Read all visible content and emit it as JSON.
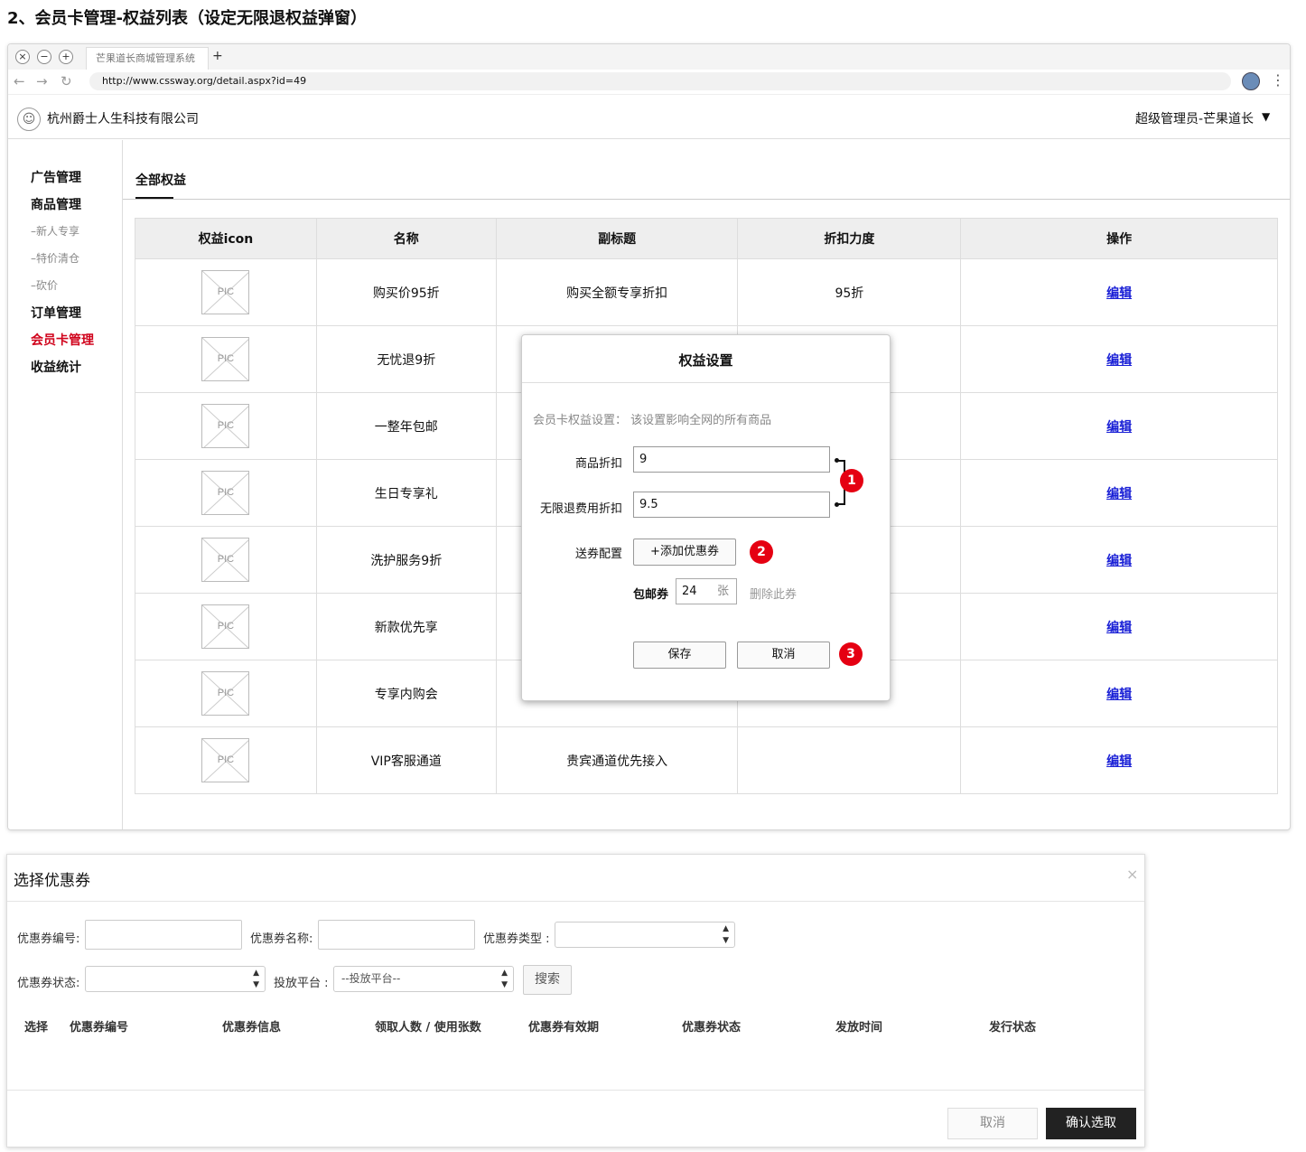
{
  "page_heading": "2、会员卡管理-权益列表（设定无限退权益弹窗）",
  "browser": {
    "window_buttons": [
      "×",
      "−",
      "+"
    ],
    "tab_title": "芒果道长商城管理系统",
    "new_tab": "+",
    "url": "http://www.cssway.org/detail.aspx?id=49"
  },
  "header": {
    "company": "杭州爵士人生科技有限公司",
    "user": "超级管理员-芒果道长"
  },
  "sidebar": {
    "items": [
      {
        "label": "广告管理",
        "type": "main"
      },
      {
        "label": "商品管理",
        "type": "main"
      },
      {
        "label": "–新人专享",
        "type": "sub"
      },
      {
        "label": "–特价清仓",
        "type": "sub"
      },
      {
        "label": "–砍价",
        "type": "sub"
      },
      {
        "label": "订单管理",
        "type": "main"
      },
      {
        "label": "会员卡管理",
        "type": "active"
      },
      {
        "label": "收益统计",
        "type": "main"
      }
    ]
  },
  "content": {
    "tab": "全部权益",
    "table": {
      "headers": [
        "权益icon",
        "名称",
        "副标题",
        "折扣力度",
        "操作"
      ],
      "pic_label": "PIC",
      "edit_label": "编辑",
      "rows": [
        {
          "name": "购买价95折",
          "subtitle": "购买全额专享折扣",
          "discount": "95折"
        },
        {
          "name": "无忧退9折",
          "subtitle": "",
          "discount": ""
        },
        {
          "name": "一整年包邮",
          "subtitle": "",
          "discount": ""
        },
        {
          "name": "生日专享礼",
          "subtitle": "",
          "discount": ""
        },
        {
          "name": "洗护服务9折",
          "subtitle": "",
          "discount": ""
        },
        {
          "name": "新款优先享",
          "subtitle": "",
          "discount": ""
        },
        {
          "name": "专享内购会",
          "subtitle": "",
          "discount": ""
        },
        {
          "name": "VIP客服通道",
          "subtitle": "贵宾通道优先接入",
          "discount": ""
        }
      ]
    }
  },
  "modal": {
    "title": "权益设置",
    "hint": "会员卡权益设置： 该设置影响全网的所有商品",
    "goods_discount_label": "商品折扣",
    "goods_discount_value": "9",
    "return_fee_label": "无限退费用折扣",
    "return_fee_value": "9.5",
    "coupon_config_label": "送券配置",
    "add_coupon_label": "+添加优惠券",
    "coupon_name": "包邮券",
    "coupon_qty": "24",
    "coupon_unit": "张",
    "delete_coupon": "删除此券",
    "save": "保存",
    "cancel": "取消",
    "badges": [
      "1",
      "2",
      "3"
    ],
    "badge_color": "#e50012"
  },
  "coupon_dialog": {
    "title": "选择优惠券",
    "close": "×",
    "code_label": "优惠券编号:",
    "name_label": "优惠券名称:",
    "type_label": "优惠券类型 :",
    "status_label": "优惠券状态:",
    "platform_label": "投放平台 :",
    "platform_placeholder": "--投放平台--",
    "search": "搜索",
    "columns": [
      "选择",
      "优惠券编号",
      "优惠券信息",
      "领取人数 / 使用张数",
      "优惠券有效期",
      "优惠券状态",
      "发放时间",
      "发行状态"
    ],
    "cancel": "取消",
    "confirm": "确认选取"
  }
}
